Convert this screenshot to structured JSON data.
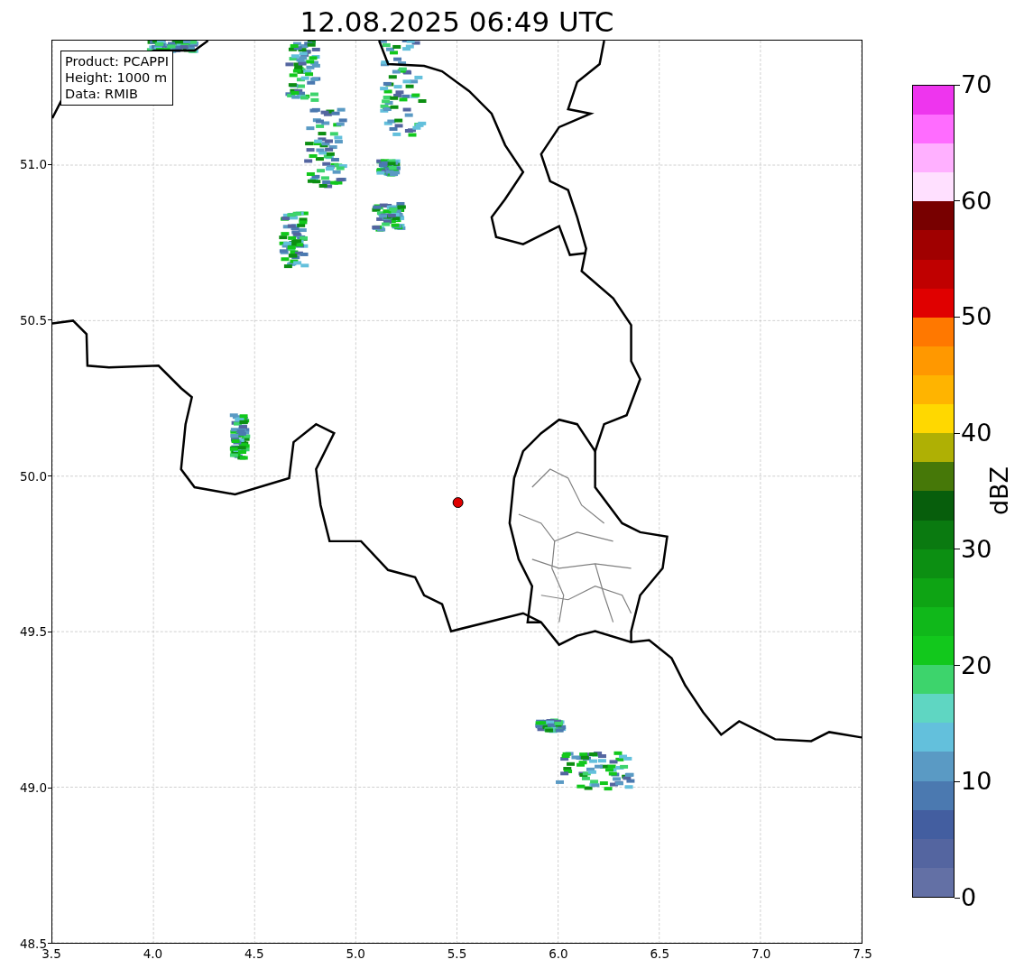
{
  "title": "12.08.2025 06:49 UTC",
  "info_box": {
    "lines": [
      "Product: PCAPPI",
      "Height: 1000 m",
      "Data: RMIB"
    ]
  },
  "map": {
    "xticks": [
      "3.5",
      "4.0",
      "4.5",
      "5.0",
      "5.5",
      "6.0",
      "6.5",
      "7.0",
      "7.5"
    ],
    "yticks": [
      "51.0",
      "50.5",
      "50.0",
      "49.5",
      "49.0",
      "48.5"
    ]
  },
  "colorbar": {
    "label": "dBZ",
    "ticks": [
      "70",
      "60",
      "50",
      "40",
      "30",
      "20",
      "10",
      "0"
    ],
    "bins": [
      {
        "color": "#6370a5"
      },
      {
        "color": "#5465a0"
      },
      {
        "color": "#435ea0"
      },
      {
        "color": "#4b79b0"
      },
      {
        "color": "#5a9ac4"
      },
      {
        "color": "#63c0dc"
      },
      {
        "color": "#5fd6c2"
      },
      {
        "color": "#3dd46c"
      },
      {
        "color": "#12c81c"
      },
      {
        "color": "#10b81a"
      },
      {
        "color": "#0ea414"
      },
      {
        "color": "#0c8f12"
      },
      {
        "color": "#0a7a10"
      },
      {
        "color": "#075e0c"
      },
      {
        "color": "#467808"
      },
      {
        "color": "#afb004"
      },
      {
        "color": "#ffd800"
      },
      {
        "color": "#ffb400"
      },
      {
        "color": "#ff9800"
      },
      {
        "color": "#ff7800"
      },
      {
        "color": "#e00000"
      },
      {
        "color": "#c00000"
      },
      {
        "color": "#a00000"
      },
      {
        "color": "#780000"
      },
      {
        "color": "#ffe0ff"
      },
      {
        "color": "#ffb0ff"
      },
      {
        "color": "#ff6cff"
      },
      {
        "color": "#ee35ee"
      }
    ]
  }
}
